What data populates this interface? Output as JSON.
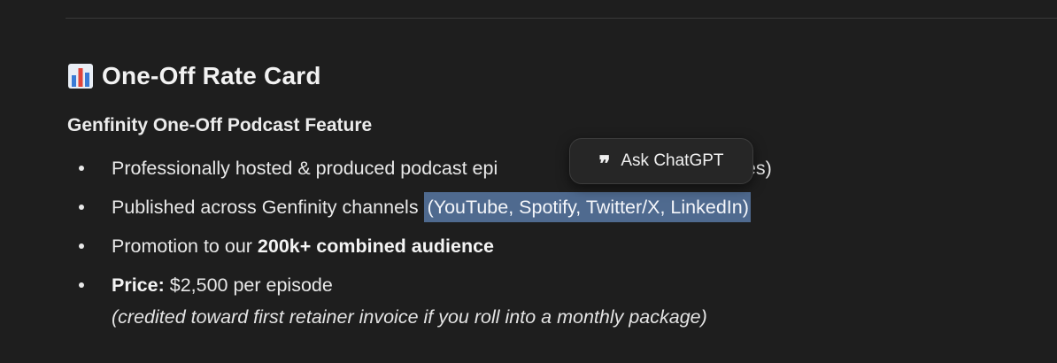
{
  "heading": {
    "icon": "bar-chart-icon",
    "title": "One-Off Rate Card"
  },
  "subheading": "Genfinity One-Off Podcast Feature",
  "bullets": [
    {
      "text": "Professionally hosted & produced podcast epi",
      "hidden_tail": "tes)"
    },
    {
      "text": "Published across Genfinity channels ",
      "selected_text": "(YouTube, Spotify, Twitter/X, LinkedIn)"
    },
    {
      "prefix": "Promotion to our ",
      "bold": "200k+ combined audience"
    },
    {
      "bold": "Price:",
      "suffix": " $2,500 per episode"
    }
  ],
  "note": "(credited toward first retainer invoice if you roll into a monthly package)",
  "popover": {
    "icon": "quote-icon",
    "label": "Ask ChatGPT"
  },
  "colors": {
    "background": "#1e1e1e",
    "selection": "#4f6a8f",
    "popover_bg": "#262626"
  }
}
